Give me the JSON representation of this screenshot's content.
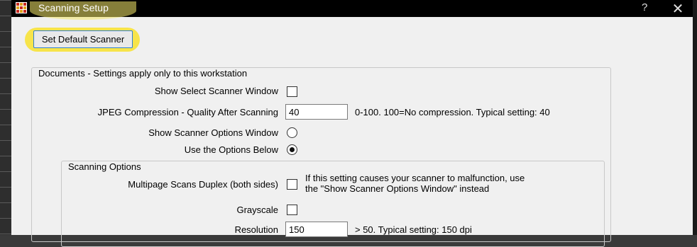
{
  "window": {
    "title": "Scanning Setup",
    "help_symbol": "?",
    "close_symbol": "✕"
  },
  "toolbar": {
    "set_default_scanner_label": "Set Default Scanner"
  },
  "documents_group": {
    "title": "Documents - Settings apply only to this workstation",
    "show_select_scanner_label": "Show Select Scanner Window",
    "show_select_scanner_checked": false,
    "jpeg_label": "JPEG Compression - Quality After Scanning",
    "jpeg_value": "40",
    "jpeg_hint": "0-100. 100=No compression.  Typical setting: 40",
    "show_options_label": "Show Scanner Options Window",
    "show_options_selected": false,
    "use_options_label": "Use the Options Below",
    "use_options_selected": true
  },
  "scanning_options": {
    "title": "Scanning Options",
    "duplex_label": "Multipage Scans Duplex (both sides)",
    "duplex_checked": false,
    "duplex_hint_line1": "If this setting causes your scanner to malfunction, use",
    "duplex_hint_line2": "the \"Show Scanner Options Window\" instead",
    "grayscale_label": "Grayscale",
    "grayscale_checked": false,
    "resolution_label": "Resolution",
    "resolution_value": "150",
    "resolution_hint": "> 50. Typical setting: 150 dpi"
  }
}
